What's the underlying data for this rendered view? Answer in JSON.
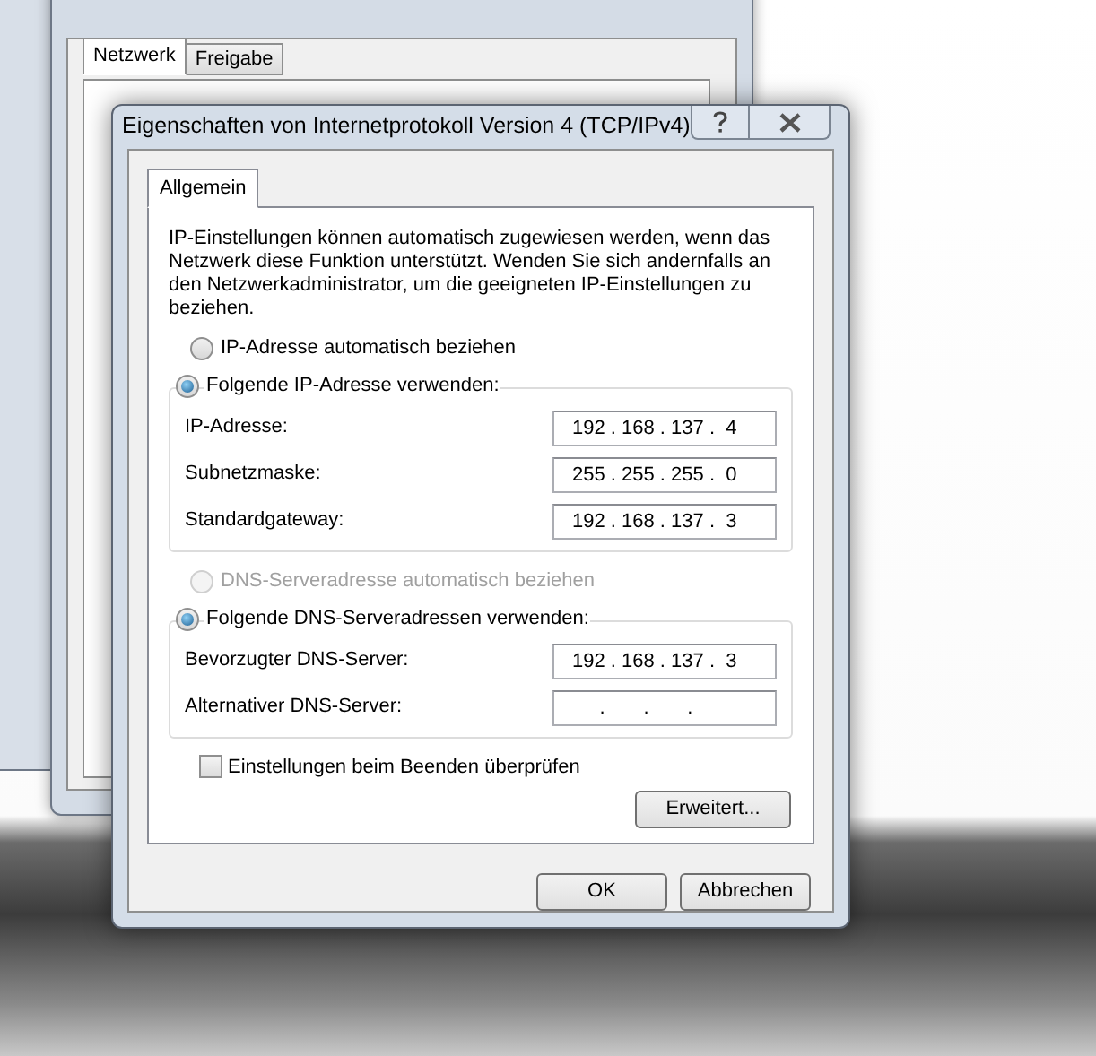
{
  "background_window": {
    "tabs": [
      {
        "label": "Netzwerk",
        "selected": true
      },
      {
        "label": "Freigabe",
        "selected": false
      }
    ]
  },
  "dialog": {
    "title": "Eigenschaften von Internetprotokoll Version 4 (TCP/IPv4)",
    "tabs": [
      {
        "label": "Allgemein",
        "selected": true
      }
    ],
    "description": "IP-Einstellungen können automatisch zugewiesen werden, wenn das Netzwerk diese Funktion unterstützt. Wenden Sie sich andernfalls an den Netzwerkadministrator, um die geeigneten IP-Einstellungen zu beziehen.",
    "ip_options": [
      {
        "label": "IP-Adresse automatisch beziehen",
        "selected": false,
        "disabled": false
      },
      {
        "label": "Folgende IP-Adresse verwenden:",
        "selected": true,
        "disabled": false
      }
    ],
    "ip_fields": [
      {
        "label": "IP-Adresse:",
        "value": "192 . 168 . 137 .  4"
      },
      {
        "label": "Subnetzmaske:",
        "value": "255 . 255 . 255 .  0"
      },
      {
        "label": "Standardgateway:",
        "value": "192 . 168 . 137 .  3"
      }
    ],
    "dns_options": [
      {
        "label": "DNS-Serveradresse automatisch beziehen",
        "selected": false,
        "disabled": true
      },
      {
        "label": "Folgende DNS-Serveradressen verwenden:",
        "selected": true,
        "disabled": false
      }
    ],
    "dns_fields": [
      {
        "label": "Bevorzugter DNS-Server:",
        "value": "192 . 168 . 137 .  3"
      },
      {
        "label": "Alternativer DNS-Server:",
        "value": "     .       .       .    "
      }
    ],
    "verify_checkbox": {
      "label": "Einstellungen beim Beenden überprüfen",
      "checked": false
    },
    "advanced_button": "Erweitert...",
    "buttons": [
      "OK",
      "Abbrechen"
    ]
  }
}
